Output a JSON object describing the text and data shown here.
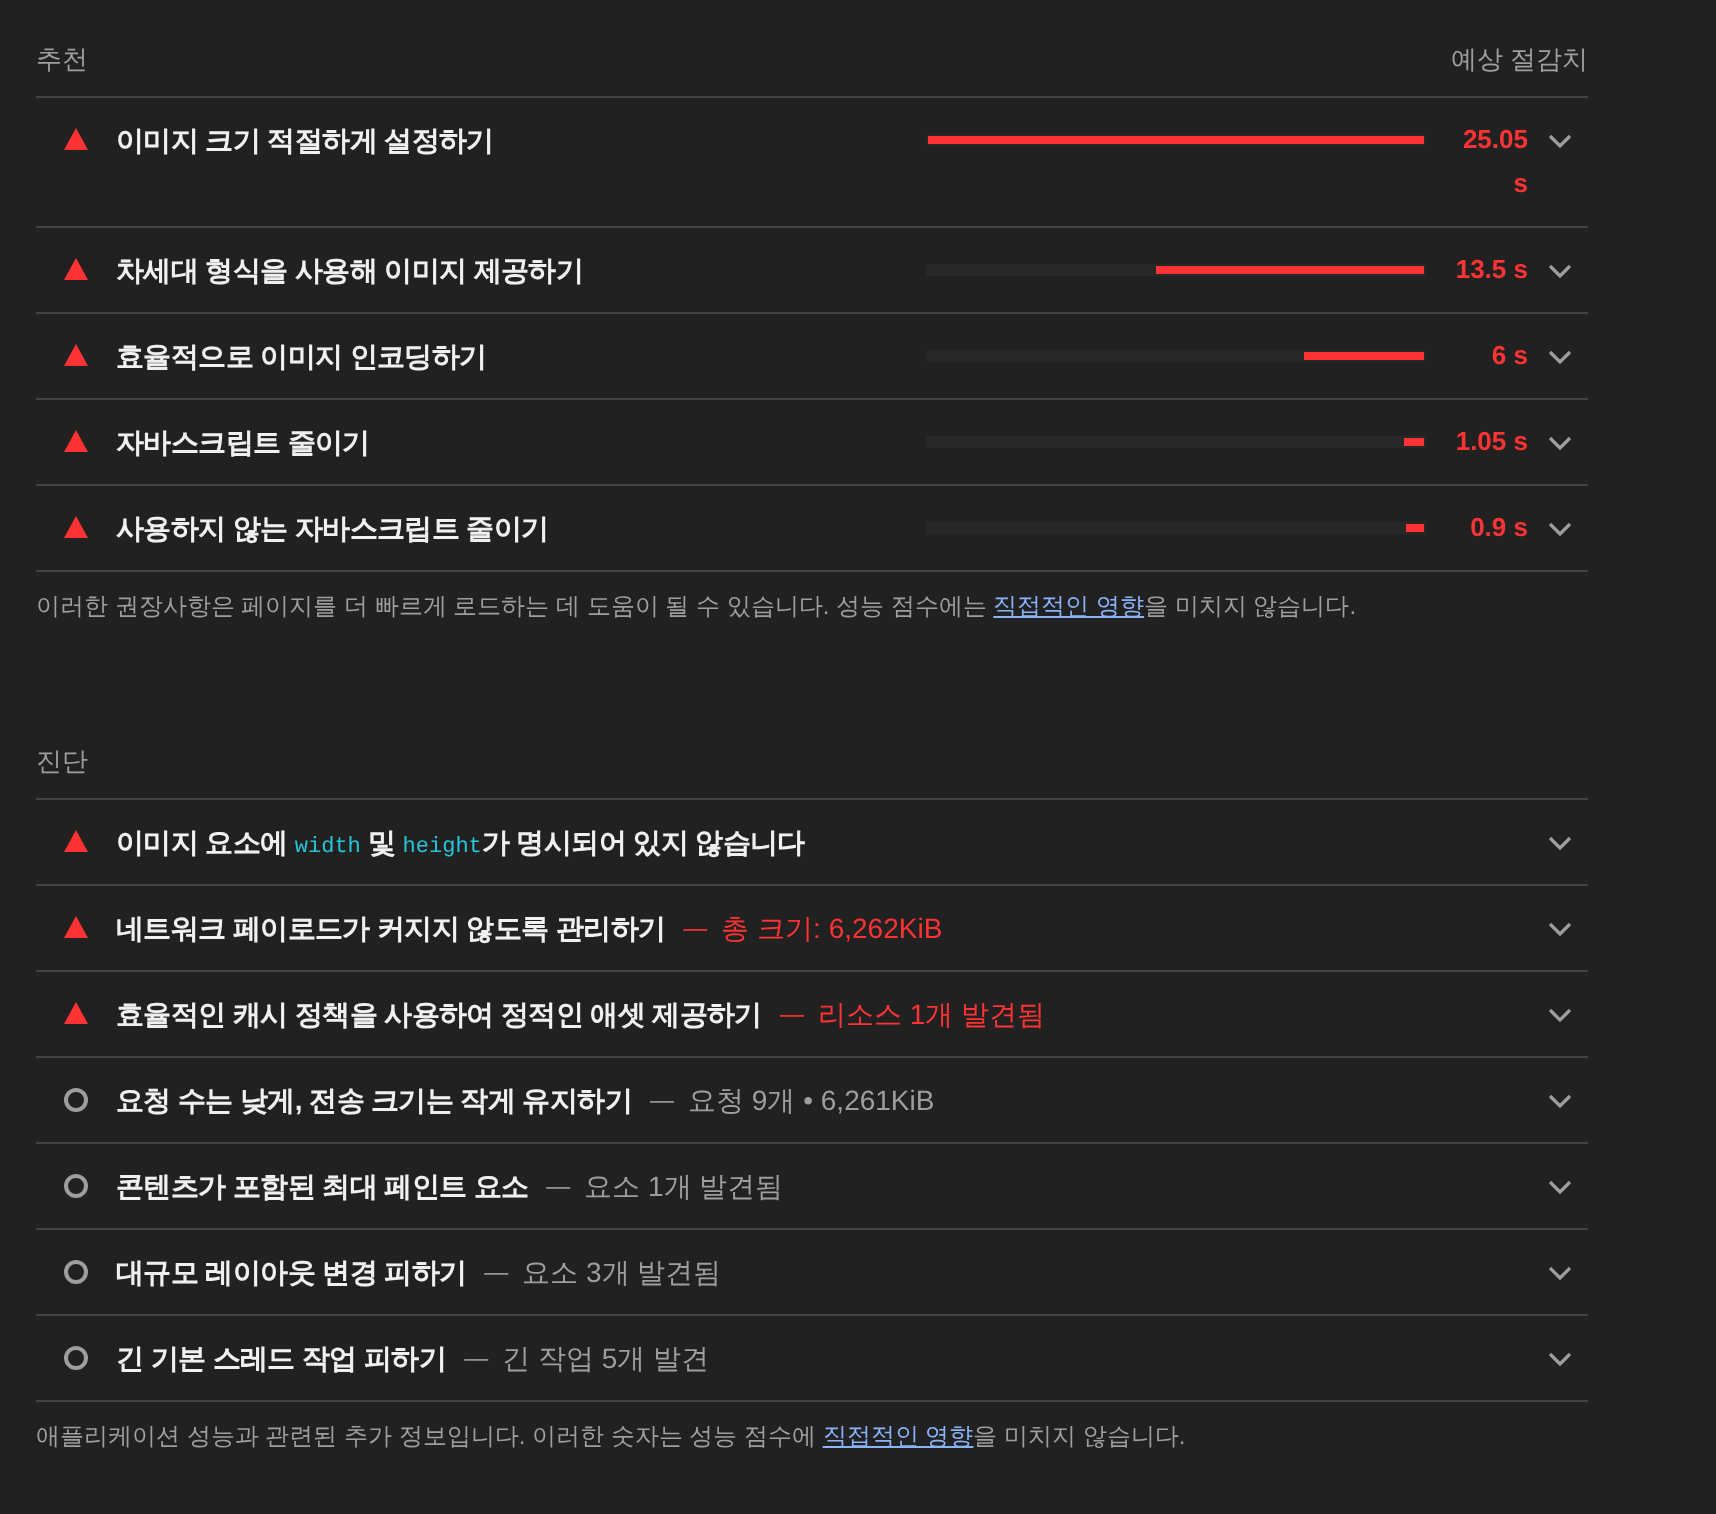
{
  "recommendations": {
    "heading": "추천",
    "savings_heading": "예상 절감치",
    "items": [
      {
        "kind": "fail",
        "title": "이미지 크기 적절하게 설정하기",
        "level": 1,
        "savings": "25.05 s"
      },
      {
        "kind": "fail",
        "title": "차세대 형식을 사용해 이미지 제공하기",
        "level": 0.54,
        "savings": "13.5 s"
      },
      {
        "kind": "fail",
        "title": "효율적으로 이미지 인코딩하기",
        "level": 0.24,
        "savings": "6 s"
      },
      {
        "kind": "fail",
        "title": "자바스크립트 줄이기",
        "level": 0.04,
        "savings": "1.05 s"
      },
      {
        "kind": "fail",
        "title": "사용하지 않는 자바스크립트 줄이기",
        "level": 0.036,
        "savings": "0.9 s"
      }
    ],
    "note": {
      "before": "이러한 권장사항은 페이지를 더 빠르게 로드하는 데 도움이 될 수 있습니다. 성능 점수에는 ",
      "link": "직접적인 영향",
      "after": "을 미치지 않습니다."
    }
  },
  "diagnostics": {
    "heading": "진단",
    "items": [
      {
        "kind": "fail",
        "title": [
          {
            "kind": "text",
            "text": "이미지 요소에 "
          },
          {
            "kind": "code",
            "text": "width"
          },
          {
            "kind": "text",
            "text": " 및 "
          },
          {
            "kind": "code",
            "text": "height"
          },
          {
            "kind": "text",
            "text": "가 명시되어 있지 않습니다"
          }
        ]
      },
      {
        "kind": "fail",
        "title": [
          {
            "kind": "text",
            "text": "네트워크 페이로드가 커지지 않도록 관리하기"
          }
        ],
        "separator": "—",
        "detail": "총 크기: 6,262KiB"
      },
      {
        "kind": "fail",
        "title": [
          {
            "kind": "text",
            "text": "효율적인 캐시 정책을 사용하여 정적인 애셋 제공하기"
          }
        ],
        "separator": "—",
        "detail": "리소스 1개 발견됨"
      },
      {
        "kind": "info",
        "title": [
          {
            "kind": "text",
            "text": "요청 수는 낮게, 전송 크기는 작게 유지하기"
          }
        ],
        "separator": "—",
        "detail": "요청 9개 • 6,261KiB"
      },
      {
        "kind": "info",
        "title": [
          {
            "kind": "text",
            "text": "콘텐츠가 포함된 최대 페인트 요소"
          }
        ],
        "separator": "—",
        "detail": "요소 1개 발견됨"
      },
      {
        "kind": "info",
        "title": [
          {
            "kind": "text",
            "text": "대규모 레이아웃 변경 피하기"
          }
        ],
        "separator": "—",
        "detail": "요소 3개 발견됨"
      },
      {
        "kind": "info",
        "title": [
          {
            "kind": "text",
            "text": "긴 기본 스레드 작업 피하기"
          }
        ],
        "separator": "—",
        "detail": "긴 작업 5개 발견"
      }
    ],
    "note": {
      "before": "애플리케이션 성능과 관련된 추가 정보입니다. 이러한 숫자는 성능 점수에 ",
      "link": "직접적인 영향",
      "after": "을 미치지 않습니다."
    }
  }
}
